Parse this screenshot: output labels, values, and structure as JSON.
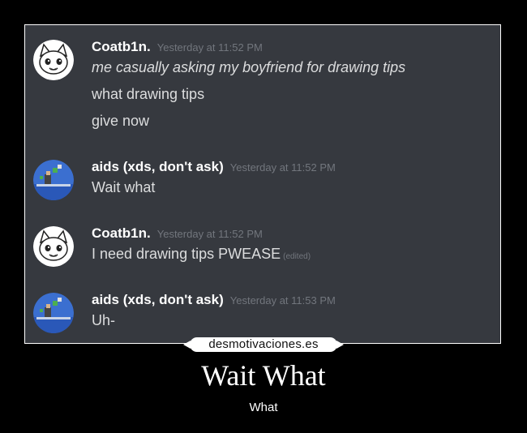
{
  "messages": [
    {
      "username": "Coatb1n.",
      "timestamp": "Yesterday at 11:52 PM",
      "avatar_icon": "white-cat-face-avatar",
      "lines": [
        {
          "text": "me casually asking my boyfriend for drawing tips",
          "italic": true
        },
        {
          "text": "what drawing tips"
        },
        {
          "text": "give now"
        }
      ]
    },
    {
      "username": "aids (xds, don't ask)",
      "timestamp": "Yesterday at 11:52 PM",
      "avatar_icon": "pixel-game-scene-avatar",
      "lines": [
        {
          "text": "Wait what"
        }
      ]
    },
    {
      "username": "Coatb1n.",
      "timestamp": "Yesterday at 11:52 PM",
      "avatar_icon": "white-cat-face-avatar",
      "lines": [
        {
          "text": "I need drawing tips PWEASE",
          "edited": "(edited)"
        }
      ]
    },
    {
      "username": "aids (xds, don't ask)",
      "timestamp": "Yesterday at 11:53 PM",
      "avatar_icon": "pixel-game-scene-avatar",
      "lines": [
        {
          "text": "Uh-"
        }
      ]
    }
  ],
  "watermark": "desmotivaciones.es",
  "poster": {
    "title": "Wait What",
    "subtitle": "What"
  },
  "colors": {
    "chat_bg": "#36393f",
    "username": "#ffffff",
    "timestamp": "#72767d",
    "message_text": "#dcddde",
    "page_bg": "#000000"
  }
}
